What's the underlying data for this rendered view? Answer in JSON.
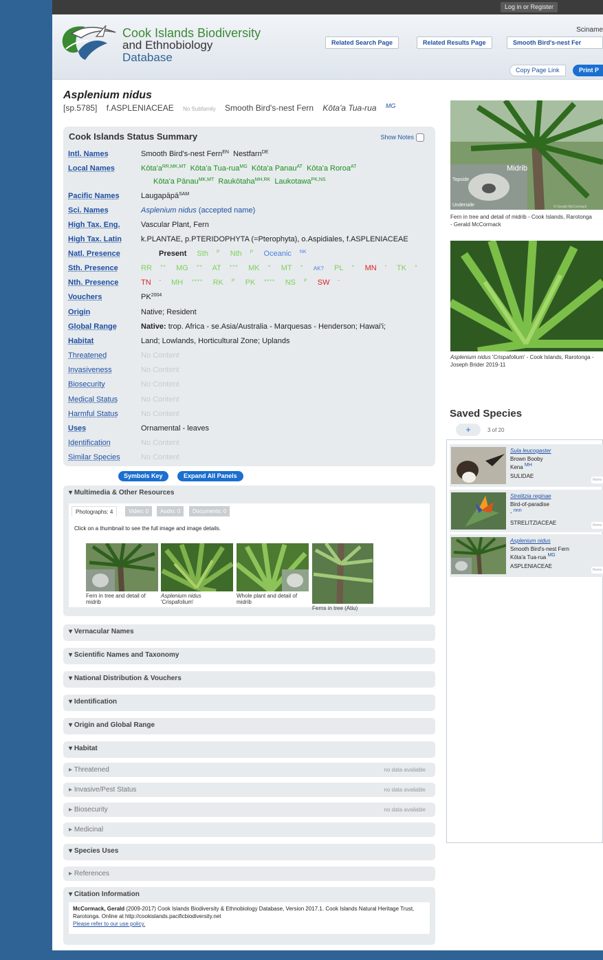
{
  "topbar": {
    "login": "Log in or Register"
  },
  "header": {
    "logo_line1": "Cook Islands Biodiversity",
    "logo_line2": "and Ethnobiology",
    "logo_line3": "Database",
    "sciname_label": "Sciname",
    "related_search": "Related Search Page",
    "related_results": "Related Results Page",
    "name_button": "Smooth Bird's-nest Fer",
    "copy_link": "Copy Page Link",
    "print_page": "Print P"
  },
  "species": {
    "title": "Asplenium nidus",
    "id": "[sp.5785]",
    "family": "f.ASPLENIACEAE",
    "subfamily": "No Subfamily",
    "common": "Smooth Bird's-nest Fern",
    "local": "Kōta'a Tua-rua",
    "local_sup": "MG"
  },
  "summary": {
    "title": "Cook Islands Status Summary",
    "show_notes": "Show Notes",
    "labels": {
      "intl": "Intl. Names",
      "local": "Local Names",
      "pacific": "Pacific Names",
      "sci": "Sci. Names",
      "hte": "High Tax. Eng.",
      "htl": "High Tax. Latin",
      "natl": "Natl. Presence",
      "sth": "Sth. Presence",
      "nth": "Nth. Presence",
      "vouchers": "Vouchers",
      "origin": "Origin",
      "global": "Global Range",
      "habitat": "Habitat",
      "threatened": "Threatened",
      "invasiveness": "Invasiveness",
      "biosecurity": "Biosecurity",
      "medical": "Medical Status",
      "harmful": "Harmful Status",
      "uses": "Uses",
      "identification": "Identification",
      "similar": "Similar Species"
    },
    "intl": [
      {
        "t": "Smooth Bird's-nest Fern",
        "s": "EN"
      },
      {
        "t": "Nestfarn",
        "s": "DE"
      }
    ],
    "local1": [
      {
        "t": "Kōta'a",
        "s": "RR,MK,MT"
      },
      {
        "t": "Kōta'a Tua-rua",
        "s": "MG"
      },
      {
        "t": "Kōta'a Panau",
        "s": "AT"
      },
      {
        "t": "Kōta'a Roroa",
        "s": "AT"
      }
    ],
    "local2": [
      {
        "t": "Kōta'a Pānau",
        "s": "MK,MT"
      },
      {
        "t": "Raukōtaha",
        "s": "MH,RK"
      },
      {
        "t": "Laukotawa",
        "s": "PK,NS"
      }
    ],
    "pacific": {
      "t": "Laugapāpā",
      "s": "SAM"
    },
    "sci": {
      "name": "Asplenium nidus",
      "rest": " (accepted name)"
    },
    "hte": "Vascular Plant, Fern",
    "htl": "k.PLANTAE, p.PTERIDOPHYTA (=Pterophyta), o.Aspidiales, f.ASPLENIACEAE",
    "natl": {
      "present": "Present",
      "sth": "Sth",
      "sth_s": "P",
      "nth": "Nth",
      "nth_s": "P",
      "oceanic": "Oceanic",
      "oceanic_s": "NK"
    },
    "sth": [
      {
        "t": "RR",
        "s": "++",
        "c": "lg"
      },
      {
        "t": "MG",
        "s": "++",
        "c": "lg"
      },
      {
        "t": "AT",
        "s": "+++",
        "c": "lg"
      },
      {
        "t": "MK",
        "s": "+",
        "c": "lg"
      },
      {
        "t": "MT",
        "s": "+",
        "c": "lg"
      },
      {
        "t": "AK?",
        "s": "",
        "c": "b"
      },
      {
        "t": "PL",
        "s": "+",
        "c": "lg"
      },
      {
        "t": "MN",
        "s": "-",
        "c": "r"
      },
      {
        "t": "TK",
        "s": "+",
        "c": "lg"
      }
    ],
    "nth": [
      {
        "t": "TN",
        "s": "-",
        "c": "r"
      },
      {
        "t": "MH",
        "s": "++++",
        "c": "lg"
      },
      {
        "t": "RK",
        "s": "P",
        "c": "lg"
      },
      {
        "t": "PK",
        "s": "++++",
        "c": "lg"
      },
      {
        "t": "NS",
        "s": "P",
        "c": "lg"
      },
      {
        "t": "SW",
        "s": "-",
        "c": "r"
      }
    ],
    "vouchers": {
      "t": "PK",
      "s": "2004"
    },
    "origin": "Native; Resident",
    "global_bold": "Native:",
    "global_rest": " trop. Africa - se.Asia/Australia - Marquesas - Henderson; Hawai'i;",
    "habitat": "Land; Lowlands, Horticultural Zone; Uplands",
    "no_content": "No Content",
    "uses": "Ornamental - leaves"
  },
  "buttons": {
    "symbols_key": "Symbols Key",
    "expand_all": "Expand All Panels"
  },
  "multimedia": {
    "title": "Multimedia & Other Resources",
    "tabs": [
      "Photographs: 4",
      "Video: 0",
      "Audio: 0",
      "Documents: 0"
    ],
    "hint": "Click on a thumbnail to see the full image and image details.",
    "captions": [
      "Fern in tree and detail of midrib",
      "Asplenium nidus",
      "'Crispafolium'",
      "Whole plant and detail of midrib",
      "Ferns in tree (Atiu)"
    ]
  },
  "panels": {
    "vernacular": "Vernacular Names",
    "scitax": "Scientific Names and Taxonomy",
    "natdist": "National Distribution & Vouchers",
    "ident": "Identification",
    "origin": "Origin and Global Range",
    "habitat": "Habitat",
    "threatened": "Threatened",
    "invasive": "Invasive/Pest Status",
    "biosecurity": "Biosecurity",
    "medicinal": "Medicinal",
    "uses": "Species Uses",
    "references": "References",
    "citation": "Citation Information",
    "no_data": "no data available"
  },
  "citation": {
    "author": "McCormack, Gerald",
    "text": " (2009-2017) Cook Islands Biodiversity & Ethnobiology Database, Version 2017.1. Cook Islands Natural Heritage Trust, Rarotonga. Online at http://cookislands.pacificbiodiversity.net",
    "link": "Please refer to our use policy."
  },
  "right": {
    "img1_midrib": "Midrib",
    "img1_topside": "Topside",
    "img1_underside": "Underside",
    "img1_credit": "© Gerald McCormack",
    "cap1": "Fern in tree and detail of midrib - Cook Islands, Rarotonga - Gerald McCormack",
    "cap2_italic": "Asplenium nidus",
    "cap2_rest": " 'Crispafolium' - Cook Islands, Rarotonga - Joseph Brider 2019-11",
    "saved_title": "Saved Species",
    "plus": "+",
    "count": "3 of 20",
    "remove": "Remo"
  },
  "saved": [
    {
      "sci": "Sula leucogaster",
      "common": "Brown Booby",
      "local": "Kena",
      "local_s": "MH",
      "family": "SULIDAE"
    },
    {
      "sci": "Strelitzia reginae",
      "common": "Bird-of-paradise",
      "local": "-",
      "local_s": "nnn",
      "family": "STRELITZIACEAE"
    },
    {
      "sci": "Asplenium nidus",
      "common": "Smooth Bird's-nest Fern",
      "local": "Kōta'a Tua-rua",
      "local_s": "MG",
      "family": "ASPLENIACEAE"
    }
  ]
}
